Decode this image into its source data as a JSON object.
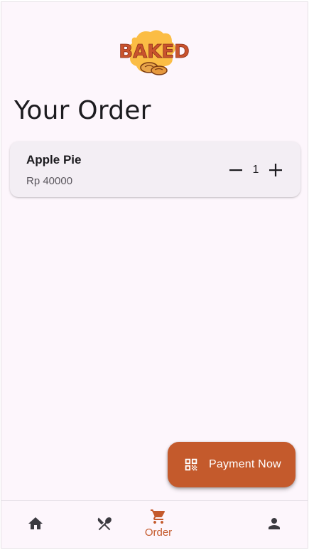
{
  "brand": {
    "logo_text": "BAKED",
    "accent_color": "#c45a2c",
    "logo_icon": "baked-logo-icon"
  },
  "page": {
    "title": "Your Order"
  },
  "order_items": [
    {
      "name": "Apple Pie",
      "price": "Rp 40000",
      "quantity": "1",
      "decrement_icon": "minus-icon",
      "increment_icon": "plus-icon"
    }
  ],
  "fab": {
    "label": "Payment Now",
    "icon": "qr-code-icon"
  },
  "bottom_nav": {
    "items": [
      {
        "id": "home",
        "icon": "home-icon",
        "label": "",
        "active": false
      },
      {
        "id": "menu",
        "icon": "utensils-icon",
        "label": "",
        "active": false
      },
      {
        "id": "order",
        "icon": "cart-icon",
        "label": "Order",
        "active": true
      },
      {
        "id": "profile",
        "icon": "person-icon",
        "label": "",
        "active": false
      }
    ]
  }
}
